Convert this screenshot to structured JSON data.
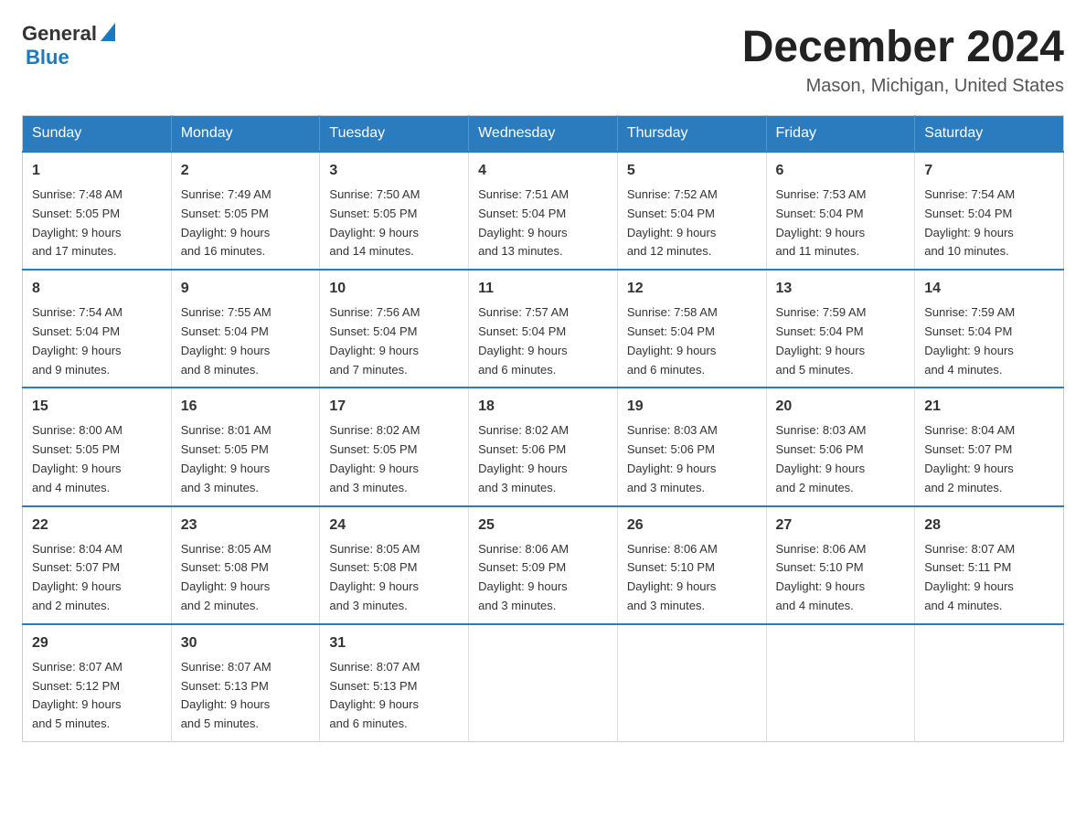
{
  "header": {
    "logo_general": "General",
    "logo_blue": "Blue",
    "month_title": "December 2024",
    "location": "Mason, Michigan, United States"
  },
  "days_of_week": [
    "Sunday",
    "Monday",
    "Tuesday",
    "Wednesday",
    "Thursday",
    "Friday",
    "Saturday"
  ],
  "weeks": [
    [
      {
        "day": "1",
        "sunrise": "7:48 AM",
        "sunset": "5:05 PM",
        "daylight": "9 hours and 17 minutes."
      },
      {
        "day": "2",
        "sunrise": "7:49 AM",
        "sunset": "5:05 PM",
        "daylight": "9 hours and 16 minutes."
      },
      {
        "day": "3",
        "sunrise": "7:50 AM",
        "sunset": "5:05 PM",
        "daylight": "9 hours and 14 minutes."
      },
      {
        "day": "4",
        "sunrise": "7:51 AM",
        "sunset": "5:04 PM",
        "daylight": "9 hours and 13 minutes."
      },
      {
        "day": "5",
        "sunrise": "7:52 AM",
        "sunset": "5:04 PM",
        "daylight": "9 hours and 12 minutes."
      },
      {
        "day": "6",
        "sunrise": "7:53 AM",
        "sunset": "5:04 PM",
        "daylight": "9 hours and 11 minutes."
      },
      {
        "day": "7",
        "sunrise": "7:54 AM",
        "sunset": "5:04 PM",
        "daylight": "9 hours and 10 minutes."
      }
    ],
    [
      {
        "day": "8",
        "sunrise": "7:54 AM",
        "sunset": "5:04 PM",
        "daylight": "9 hours and 9 minutes."
      },
      {
        "day": "9",
        "sunrise": "7:55 AM",
        "sunset": "5:04 PM",
        "daylight": "9 hours and 8 minutes."
      },
      {
        "day": "10",
        "sunrise": "7:56 AM",
        "sunset": "5:04 PM",
        "daylight": "9 hours and 7 minutes."
      },
      {
        "day": "11",
        "sunrise": "7:57 AM",
        "sunset": "5:04 PM",
        "daylight": "9 hours and 6 minutes."
      },
      {
        "day": "12",
        "sunrise": "7:58 AM",
        "sunset": "5:04 PM",
        "daylight": "9 hours and 6 minutes."
      },
      {
        "day": "13",
        "sunrise": "7:59 AM",
        "sunset": "5:04 PM",
        "daylight": "9 hours and 5 minutes."
      },
      {
        "day": "14",
        "sunrise": "7:59 AM",
        "sunset": "5:04 PM",
        "daylight": "9 hours and 4 minutes."
      }
    ],
    [
      {
        "day": "15",
        "sunrise": "8:00 AM",
        "sunset": "5:05 PM",
        "daylight": "9 hours and 4 minutes."
      },
      {
        "day": "16",
        "sunrise": "8:01 AM",
        "sunset": "5:05 PM",
        "daylight": "9 hours and 3 minutes."
      },
      {
        "day": "17",
        "sunrise": "8:02 AM",
        "sunset": "5:05 PM",
        "daylight": "9 hours and 3 minutes."
      },
      {
        "day": "18",
        "sunrise": "8:02 AM",
        "sunset": "5:06 PM",
        "daylight": "9 hours and 3 minutes."
      },
      {
        "day": "19",
        "sunrise": "8:03 AM",
        "sunset": "5:06 PM",
        "daylight": "9 hours and 3 minutes."
      },
      {
        "day": "20",
        "sunrise": "8:03 AM",
        "sunset": "5:06 PM",
        "daylight": "9 hours and 2 minutes."
      },
      {
        "day": "21",
        "sunrise": "8:04 AM",
        "sunset": "5:07 PM",
        "daylight": "9 hours and 2 minutes."
      }
    ],
    [
      {
        "day": "22",
        "sunrise": "8:04 AM",
        "sunset": "5:07 PM",
        "daylight": "9 hours and 2 minutes."
      },
      {
        "day": "23",
        "sunrise": "8:05 AM",
        "sunset": "5:08 PM",
        "daylight": "9 hours and 2 minutes."
      },
      {
        "day": "24",
        "sunrise": "8:05 AM",
        "sunset": "5:08 PM",
        "daylight": "9 hours and 3 minutes."
      },
      {
        "day": "25",
        "sunrise": "8:06 AM",
        "sunset": "5:09 PM",
        "daylight": "9 hours and 3 minutes."
      },
      {
        "day": "26",
        "sunrise": "8:06 AM",
        "sunset": "5:10 PM",
        "daylight": "9 hours and 3 minutes."
      },
      {
        "day": "27",
        "sunrise": "8:06 AM",
        "sunset": "5:10 PM",
        "daylight": "9 hours and 4 minutes."
      },
      {
        "day": "28",
        "sunrise": "8:07 AM",
        "sunset": "5:11 PM",
        "daylight": "9 hours and 4 minutes."
      }
    ],
    [
      {
        "day": "29",
        "sunrise": "8:07 AM",
        "sunset": "5:12 PM",
        "daylight": "9 hours and 5 minutes."
      },
      {
        "day": "30",
        "sunrise": "8:07 AM",
        "sunset": "5:13 PM",
        "daylight": "9 hours and 5 minutes."
      },
      {
        "day": "31",
        "sunrise": "8:07 AM",
        "sunset": "5:13 PM",
        "daylight": "9 hours and 6 minutes."
      },
      null,
      null,
      null,
      null
    ]
  ],
  "labels": {
    "sunrise": "Sunrise:",
    "sunset": "Sunset:",
    "daylight": "Daylight:"
  }
}
